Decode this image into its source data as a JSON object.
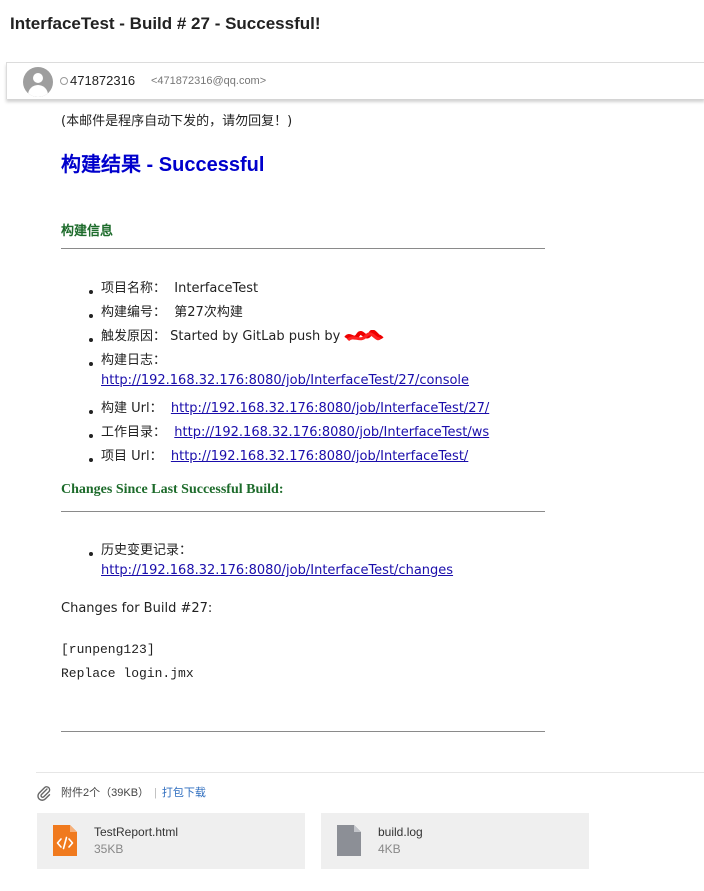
{
  "subject": "InterfaceTest - Build # 27 - Successful!",
  "sender": {
    "name": "471872316",
    "email": "<471872316@qq.com>"
  },
  "body": {
    "notice": "(本邮件是程序自动下发的，请勿回复！)",
    "result_title": "构建结果 - Successful",
    "build_info_heading": "构建信息",
    "build_info": [
      {
        "label": "项目名称：",
        "value": "InterfaceTest"
      },
      {
        "label": "构建编号：",
        "value": "第27次构建"
      },
      {
        "label": "触发原因：",
        "value": "Started by GitLab push by"
      },
      {
        "label": "构建日志：",
        "link": "http://192.168.32.176:8080/job/InterfaceTest/27/console"
      },
      {
        "label": "构建 Url：",
        "link": "http://192.168.32.176:8080/job/InterfaceTest/27/"
      },
      {
        "label": "工作目录：",
        "link": "http://192.168.32.176:8080/job/InterfaceTest/ws"
      },
      {
        "label": "项目 Url：",
        "link": "http://192.168.32.176:8080/job/InterfaceTest/"
      }
    ],
    "changes_heading": "Changes Since Last Successful Build:",
    "changes_label": "历史变更记录：",
    "changes_link": "http://192.168.32.176:8080/job/InterfaceTest/changes",
    "changes_for_build": "Changes for Build #27:",
    "commit_author": "[runpeng123]",
    "commit_message": "Replace login.jmx"
  },
  "attachments": {
    "summary": "附件2个（39KB）",
    "download_all": "打包下载",
    "files": [
      {
        "name": "TestReport.html",
        "size": "35KB",
        "icon": "html-file-icon",
        "color": "#f07a1e"
      },
      {
        "name": "build.log",
        "size": "4KB",
        "icon": "generic-file-icon",
        "color": "#8c8f96"
      }
    ]
  }
}
